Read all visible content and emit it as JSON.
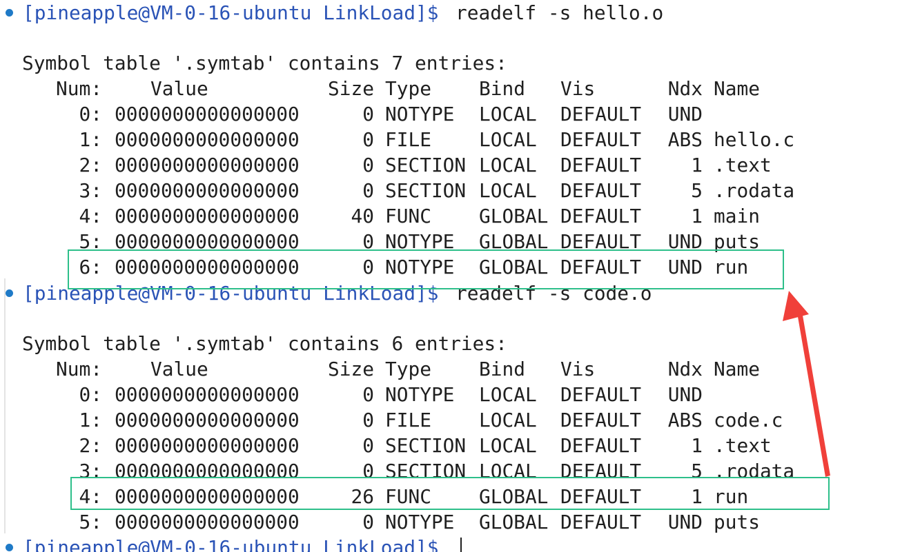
{
  "terminal": {
    "prompt": "[pineapple@VM-0-16-ubuntu LinkLoad]$",
    "blocks": [
      {
        "command": "readelf -s hello.o",
        "heading": "Symbol table '.symtab' contains 7 entries:",
        "columns": {
          "num": "Num:",
          "value": "Value",
          "size": "Size",
          "type": "Type",
          "bind": "Bind",
          "vis": "Vis",
          "ndx": "Ndx",
          "name": "Name"
        },
        "rows": [
          {
            "num": "0:",
            "value": "0000000000000000",
            "size": "0",
            "type": "NOTYPE",
            "bind": "LOCAL",
            "vis": "DEFAULT",
            "ndx": "UND",
            "name": ""
          },
          {
            "num": "1:",
            "value": "0000000000000000",
            "size": "0",
            "type": "FILE",
            "bind": "LOCAL",
            "vis": "DEFAULT",
            "ndx": "ABS",
            "name": "hello.c"
          },
          {
            "num": "2:",
            "value": "0000000000000000",
            "size": "0",
            "type": "SECTION",
            "bind": "LOCAL",
            "vis": "DEFAULT",
            "ndx": "1",
            "name": ".text"
          },
          {
            "num": "3:",
            "value": "0000000000000000",
            "size": "0",
            "type": "SECTION",
            "bind": "LOCAL",
            "vis": "DEFAULT",
            "ndx": "5",
            "name": ".rodata"
          },
          {
            "num": "4:",
            "value": "0000000000000000",
            "size": "40",
            "type": "FUNC",
            "bind": "GLOBAL",
            "vis": "DEFAULT",
            "ndx": "1",
            "name": "main"
          },
          {
            "num": "5:",
            "value": "0000000000000000",
            "size": "0",
            "type": "NOTYPE",
            "bind": "GLOBAL",
            "vis": "DEFAULT",
            "ndx": "UND",
            "name": "puts"
          },
          {
            "num": "6:",
            "value": "0000000000000000",
            "size": "0",
            "type": "NOTYPE",
            "bind": "GLOBAL",
            "vis": "DEFAULT",
            "ndx": "UND",
            "name": "run"
          }
        ]
      },
      {
        "command": "readelf -s code.o",
        "heading": "Symbol table '.symtab' contains 6 entries:",
        "columns": {
          "num": "Num:",
          "value": "Value",
          "size": "Size",
          "type": "Type",
          "bind": "Bind",
          "vis": "Vis",
          "ndx": "Ndx",
          "name": "Name"
        },
        "rows": [
          {
            "num": "0:",
            "value": "0000000000000000",
            "size": "0",
            "type": "NOTYPE",
            "bind": "LOCAL",
            "vis": "DEFAULT",
            "ndx": "UND",
            "name": ""
          },
          {
            "num": "1:",
            "value": "0000000000000000",
            "size": "0",
            "type": "FILE",
            "bind": "LOCAL",
            "vis": "DEFAULT",
            "ndx": "ABS",
            "name": "code.c"
          },
          {
            "num": "2:",
            "value": "0000000000000000",
            "size": "0",
            "type": "SECTION",
            "bind": "LOCAL",
            "vis": "DEFAULT",
            "ndx": "1",
            "name": ".text"
          },
          {
            "num": "3:",
            "value": "0000000000000000",
            "size": "0",
            "type": "SECTION",
            "bind": "LOCAL",
            "vis": "DEFAULT",
            "ndx": "5",
            "name": ".rodata"
          },
          {
            "num": "4:",
            "value": "0000000000000000",
            "size": "26",
            "type": "FUNC",
            "bind": "GLOBAL",
            "vis": "DEFAULT",
            "ndx": "1",
            "name": "run"
          },
          {
            "num": "5:",
            "value": "0000000000000000",
            "size": "0",
            "type": "NOTYPE",
            "bind": "GLOBAL",
            "vis": "DEFAULT",
            "ndx": "UND",
            "name": "puts"
          }
        ]
      }
    ],
    "final_command": ""
  },
  "colors": {
    "prompt": "#2a53b6",
    "status_dot": "#1f7ac7",
    "highlight_box": "#2dbf8a",
    "arrow": "#f0403a"
  },
  "icons": {
    "status_dot": "circle-dot-icon",
    "arrow": "red-arrow-icon"
  }
}
